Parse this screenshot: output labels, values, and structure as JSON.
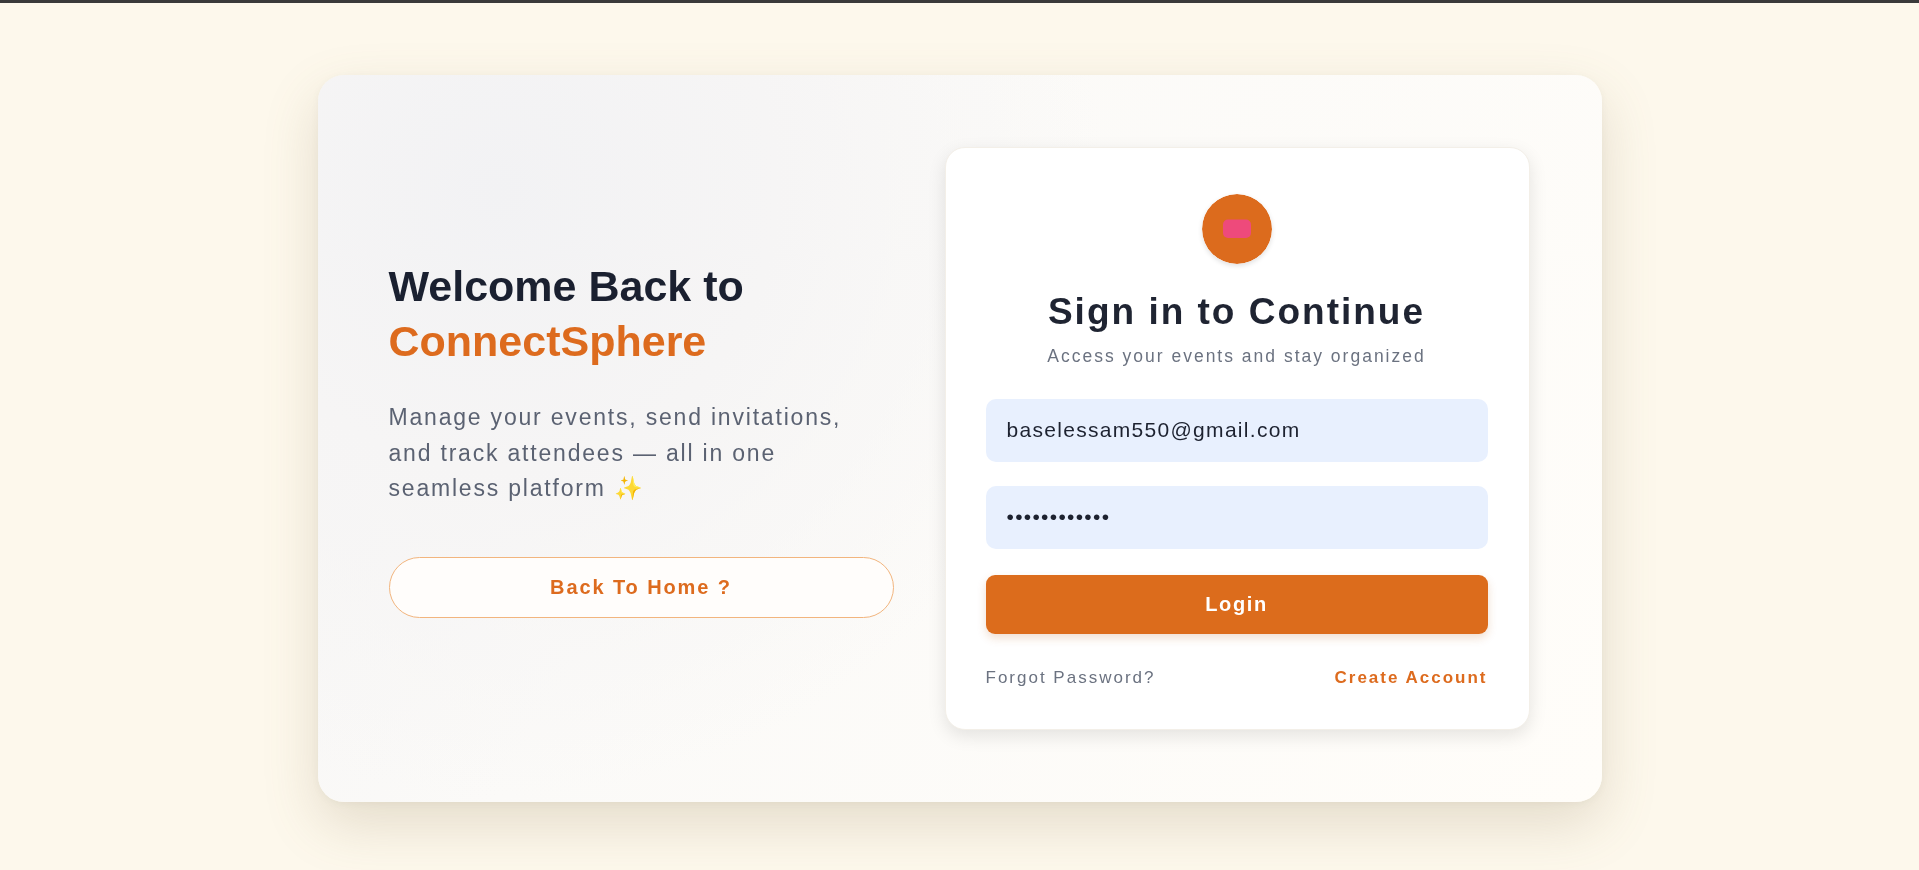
{
  "hero": {
    "heading": "Welcome Back to",
    "brand": "ConnectSphere",
    "description": "Manage your events, send invitations, and track attendees — all in one seamless platform ✨",
    "home_button": "Back To Home ?"
  },
  "sign_in": {
    "title": "Sign in to Continue",
    "subtitle": "Access your events and stay organized",
    "fields": [
      {
        "kind": "email",
        "value": "baselessam550@gmail.com"
      },
      {
        "kind": "password",
        "value": "••••••••••••"
      }
    ],
    "submit": "Login",
    "links": [
      {
        "kind": "muted",
        "label": "Forgot Password?"
      },
      {
        "kind": "accent",
        "label": "Create Account"
      }
    ]
  }
}
